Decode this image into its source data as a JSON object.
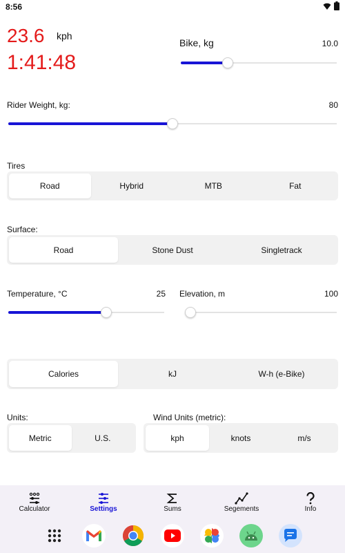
{
  "status": {
    "time": "8:56"
  },
  "readout": {
    "speed": "23.6",
    "speed_unit": "kph",
    "elapsed": "1:41:48"
  },
  "bike": {
    "label": "Bike, kg",
    "value": "10.0",
    "fraction": 0.3
  },
  "rider": {
    "label": "Rider Weight, kg:",
    "value": "80",
    "fraction": 0.5
  },
  "tires": {
    "label": "Tires",
    "options": [
      "Road",
      "Hybrid",
      "MTB",
      "Fat"
    ],
    "selected": 0
  },
  "surface": {
    "label": "Surface:",
    "options": [
      "Road",
      "Stone Dust",
      "Singletrack"
    ],
    "selected": 0
  },
  "temperature": {
    "label": "Temperature, °C",
    "value": "25",
    "fraction": 0.63
  },
  "elevation": {
    "label": "Elevation, m",
    "value": "100",
    "fraction": 0.0
  },
  "energy": {
    "options": [
      "Calories",
      "kJ",
      "W-h (e-Bike)"
    ],
    "selected": 0
  },
  "units": {
    "label": "Units:",
    "options": [
      "Metric",
      "U.S."
    ],
    "selected": 0
  },
  "wind_units": {
    "label": "Wind Units (metric):",
    "options": [
      "kph",
      "knots",
      "m/s"
    ],
    "selected": 0
  },
  "tabs": [
    {
      "label": "Calculator",
      "icon": "calculator-icon"
    },
    {
      "label": "Settings",
      "icon": "sliders-icon",
      "active": true
    },
    {
      "label": "Sums",
      "icon": "sigma-icon"
    },
    {
      "label": "Segements",
      "icon": "chart-line-icon"
    },
    {
      "label": "Info",
      "icon": "question-icon"
    }
  ],
  "dock": [
    "apps-grid-icon",
    "gmail-icon",
    "chrome-icon",
    "youtube-icon",
    "photos-icon",
    "android-icon",
    "messages-icon"
  ],
  "colors": {
    "accent": "#1814d6",
    "readout": "#e41b1b"
  }
}
